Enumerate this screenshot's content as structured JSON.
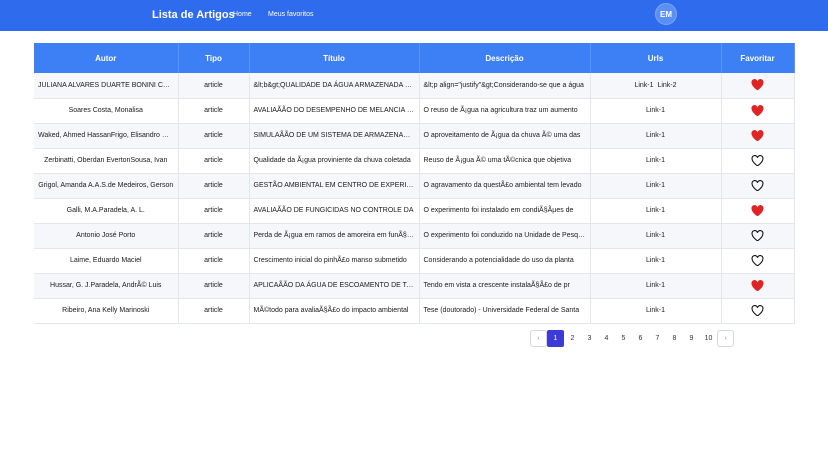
{
  "nav": {
    "brand": "Lista de Artigos",
    "home": "Home",
    "favorites": "Meus favoritos",
    "avatar": "EM"
  },
  "table": {
    "headers": [
      "Autor",
      "Tipo",
      "Título",
      "Descrição",
      "Urls",
      "Favoritar"
    ],
    "rows": [
      {
        "autor": "JULIANA ALVARES DUARTE BONINI CAMPOS",
        "tipo": "article",
        "titulo": "&lt;b&gt;QUALIDADE DA ÁGUA ARMAZENADA EM CISTERNAS",
        "descricao": "&lt;p align=\"justify\"&gt;Considerando-se que a água",
        "links": [
          "Link-1",
          "Link-2"
        ],
        "favorito": true
      },
      {
        "autor": "Soares Costa, Monalisa",
        "tipo": "article",
        "titulo": "AVALIAÃÃO DO DESEMPENHO DE MELANCIA E FEIJÃO",
        "descricao": "O reuso de Ã¡gua na agricultura traz um aumento",
        "links": [
          "Link-1"
        ],
        "favorito": true
      },
      {
        "autor": "Waked, Ahmed HassanFrigo, Elisandro Pires",
        "tipo": "article",
        "titulo": "SIMULAÃÃO DE UM SISTEMA DE ARMAZENAMENTO",
        "descricao": "O aproveitamento de Ã¡gua da chuva Ã© uma das",
        "links": [
          "Link-1"
        ],
        "favorito": true
      },
      {
        "autor": "Zerbinatti, Oberdan EvertonSousa, Ivan",
        "tipo": "article",
        "titulo": "Qualidade da Ã¡gua proviniente da chuva coletada",
        "descricao": "Reuso de Ã¡gua Ã© uma tÃ©cnica que objetiva",
        "links": [
          "Link-1"
        ],
        "favorito": false
      },
      {
        "autor": "Grigol, Amanda A.A.S.de Medeiros, Gerson",
        "tipo": "article",
        "titulo": "GESTÃO AMBIENTAL EM CENTRO DE EXPERIMENTOS",
        "descricao": "O agravamento da questÃ£o ambiental tem levado",
        "links": [
          "Link-1"
        ],
        "favorito": false
      },
      {
        "autor": "Galli, M.A.Paradela, A. L.",
        "tipo": "article",
        "titulo": "AVALIAÃÃO DE FUNGICIDAS NO CONTROLE DA",
        "descricao": "O experimento foi instalado em condiÃ§Ãµes de",
        "links": [
          "Link-1"
        ],
        "favorito": true
      },
      {
        "autor": "Antonio José Porto",
        "tipo": "article",
        "titulo": "Perda de Ã¡gua em ramos de amoreira em funÃ§Ã£o",
        "descricao": "O experimento foi conduzido na Unidade de Pesquisa",
        "links": [
          "Link-1"
        ],
        "favorito": false
      },
      {
        "autor": "Laime, Eduardo Maciel",
        "tipo": "article",
        "titulo": "Crescimento inicial do pinhÃ£o manso submetido",
        "descricao": "Considerando a potencialidade do uso da planta",
        "links": [
          "Link-1"
        ],
        "favorito": false
      },
      {
        "autor": "Hussar, G. J.Paradela, AndrÃ© Luis",
        "tipo": "article",
        "titulo": "APLICAÃÃO DA ÁGUA DE ESCOAMENTO DE TANQUES",
        "descricao": "Tendo em vista a crescente instalaÃ§Ã£o de pr",
        "links": [
          "Link-1"
        ],
        "favorito": true
      },
      {
        "autor": "Ribeiro, Ana Kelly Marinoski",
        "tipo": "article",
        "titulo": "MÃ©todo para avaliaÃ§Ã£o do impacto ambiental",
        "descricao": "Tese (doutorado) - Universidade Federal de Santa",
        "links": [
          "Link-1"
        ],
        "favorito": false
      }
    ]
  },
  "pagination": {
    "prev": "‹",
    "next": "›",
    "pages": [
      "1",
      "2",
      "3",
      "4",
      "5",
      "6",
      "7",
      "8",
      "9",
      "10"
    ],
    "current": "1"
  },
  "colors": {
    "nav": "#2f6bed",
    "header": "#3d7ff5",
    "heart": "#e02424",
    "active_page": "#3d3ad6"
  }
}
